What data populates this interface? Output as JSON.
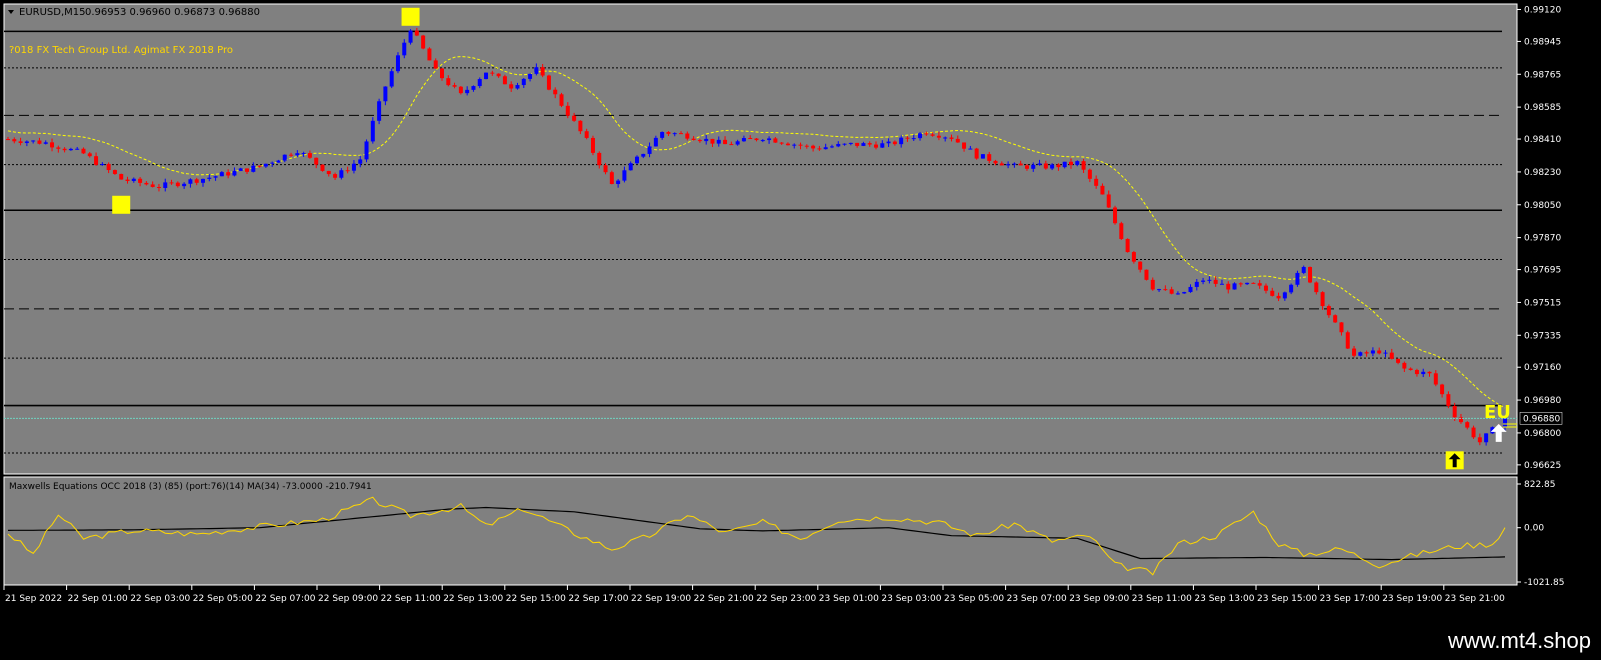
{
  "window": {
    "symbol_label": "EURUSD,M15",
    "ohlc_text": "0.96953 0.96960 0.96873 0.96880",
    "copyright": "?018 FX Tech Group Ltd. Agimat FX 2018 Pro",
    "current_price": "0.96880",
    "eu_label": "EU"
  },
  "indicator": {
    "title": "Maxwells Equations OCC 2018 (3) (85) (port:76)(14) MA(34) -73.0000 -210.7941",
    "levels": [
      "822.85",
      "0.00",
      "-1021.85"
    ],
    "ylim": [
      -1021.85,
      822.85
    ]
  },
  "price_axis": {
    "labels": [
      "0.99120",
      "0.98945",
      "0.98765",
      "0.98585",
      "0.98410",
      "0.98230",
      "0.98050",
      "0.97870",
      "0.97695",
      "0.97515",
      "0.97335",
      "0.97160",
      "0.96980",
      "0.96800",
      "0.96625"
    ],
    "ylim": [
      0.96575,
      0.9915
    ]
  },
  "time_axis": {
    "labels": [
      "21 Sep 2022",
      "22 Sep 01:00",
      "22 Sep 03:00",
      "22 Sep 05:00",
      "22 Sep 07:00",
      "22 Sep 09:00",
      "22 Sep 11:00",
      "22 Sep 13:00",
      "22 Sep 15:00",
      "22 Sep 17:00",
      "22 Sep 19:00",
      "22 Sep 21:00",
      "22 Sep 23:00",
      "23 Sep 01:00",
      "23 Sep 03:00",
      "23 Sep 05:00",
      "23 Sep 07:00",
      "23 Sep 09:00",
      "23 Sep 11:00",
      "23 Sep 13:00",
      "23 Sep 15:00",
      "23 Sep 17:00",
      "23 Sep 19:00",
      "23 Sep 21:00"
    ]
  },
  "colors": {
    "background": "#808080",
    "bull": "#0000ff",
    "bear": "#ff0000",
    "signal": "#ffff00",
    "ma_line": "#000000",
    "osc_line": "#ffd700",
    "text": "#000000"
  },
  "chart_data": {
    "type": "candlestick",
    "price_keypoints": [
      [
        0,
        0.9841
      ],
      [
        6,
        0.9839
      ],
      [
        12,
        0.9833
      ],
      [
        18,
        0.9819
      ],
      [
        24,
        0.9815
      ],
      [
        32,
        0.982
      ],
      [
        40,
        0.9826
      ],
      [
        46,
        0.9835
      ],
      [
        52,
        0.982
      ],
      [
        56,
        0.983
      ],
      [
        60,
        0.987
      ],
      [
        64,
        0.9902
      ],
      [
        68,
        0.9878
      ],
      [
        72,
        0.9865
      ],
      [
        76,
        0.9878
      ],
      [
        80,
        0.987
      ],
      [
        84,
        0.9879
      ],
      [
        88,
        0.986
      ],
      [
        92,
        0.984
      ],
      [
        96,
        0.9816
      ],
      [
        100,
        0.983
      ],
      [
        104,
        0.9845
      ],
      [
        108,
        0.9843
      ],
      [
        114,
        0.9838
      ],
      [
        120,
        0.9842
      ],
      [
        128,
        0.9836
      ],
      [
        134,
        0.9838
      ],
      [
        140,
        0.9838
      ],
      [
        146,
        0.9845
      ],
      [
        150,
        0.9842
      ],
      [
        154,
        0.9832
      ],
      [
        160,
        0.9826
      ],
      [
        166,
        0.9826
      ],
      [
        170,
        0.9828
      ],
      [
        174,
        0.981
      ],
      [
        178,
        0.978
      ],
      [
        182,
        0.976
      ],
      [
        186,
        0.9755
      ],
      [
        190,
        0.9764
      ],
      [
        194,
        0.976
      ],
      [
        198,
        0.9761
      ],
      [
        202,
        0.9755
      ],
      [
        206,
        0.977
      ],
      [
        210,
        0.9745
      ],
      [
        214,
        0.9722
      ],
      [
        218,
        0.9725
      ],
      [
        222,
        0.9715
      ],
      [
        226,
        0.9712
      ],
      [
        230,
        0.969
      ],
      [
        234,
        0.9675
      ],
      [
        238,
        0.9688
      ]
    ],
    "candle_count": 239,
    "signals": [
      {
        "type": "box",
        "index": 18,
        "price": 0.9805
      },
      {
        "type": "box",
        "index": 64,
        "price": 0.9908
      },
      {
        "type": "buy-arrow",
        "index": 230,
        "price": 0.9665
      },
      {
        "type": "white-arrow",
        "index": 237,
        "price": 0.968
      }
    ],
    "horizontal_levels": [
      {
        "price": 0.99,
        "style": "solid"
      },
      {
        "price": 0.988,
        "style": "dotted"
      },
      {
        "price": 0.9854,
        "style": "dashed"
      },
      {
        "price": 0.9827,
        "style": "dotted"
      },
      {
        "price": 0.9802,
        "style": "solid"
      },
      {
        "price": 0.9775,
        "style": "dotted"
      },
      {
        "price": 0.9748,
        "style": "dashed"
      },
      {
        "price": 0.9721,
        "style": "dotted"
      },
      {
        "price": 0.9695,
        "style": "solid"
      },
      {
        "price": 0.9669,
        "style": "dotted"
      }
    ],
    "osc_keypoints": [
      [
        0,
        -100
      ],
      [
        4,
        -500
      ],
      [
        8,
        250
      ],
      [
        12,
        -200
      ],
      [
        20,
        -50
      ],
      [
        30,
        -120
      ],
      [
        40,
        20
      ],
      [
        50,
        150
      ],
      [
        58,
        520
      ],
      [
        64,
        230
      ],
      [
        72,
        400
      ],
      [
        76,
        30
      ],
      [
        82,
        360
      ],
      [
        90,
        -100
      ],
      [
        96,
        -400
      ],
      [
        102,
        -150
      ],
      [
        108,
        250
      ],
      [
        114,
        -100
      ],
      [
        120,
        100
      ],
      [
        126,
        -200
      ],
      [
        132,
        150
      ],
      [
        140,
        200
      ],
      [
        148,
        100
      ],
      [
        154,
        -150
      ],
      [
        160,
        80
      ],
      [
        166,
        -250
      ],
      [
        172,
        -150
      ],
      [
        176,
        -700
      ],
      [
        182,
        -850
      ],
      [
        186,
        -300
      ],
      [
        192,
        -150
      ],
      [
        198,
        300
      ],
      [
        202,
        -300
      ],
      [
        206,
        -500
      ],
      [
        212,
        -400
      ],
      [
        218,
        -700
      ],
      [
        224,
        -500
      ],
      [
        230,
        -350
      ],
      [
        236,
        -300
      ],
      [
        238,
        0
      ]
    ],
    "ma_keypoints": [
      [
        0,
        -50
      ],
      [
        20,
        -40
      ],
      [
        40,
        0
      ],
      [
        60,
        230
      ],
      [
        70,
        350
      ],
      [
        76,
        380
      ],
      [
        90,
        300
      ],
      [
        110,
        -20
      ],
      [
        120,
        -60
      ],
      [
        140,
        0
      ],
      [
        150,
        -150
      ],
      [
        170,
        -200
      ],
      [
        180,
        -580
      ],
      [
        200,
        -560
      ],
      [
        220,
        -600
      ],
      [
        238,
        -550
      ]
    ]
  }
}
